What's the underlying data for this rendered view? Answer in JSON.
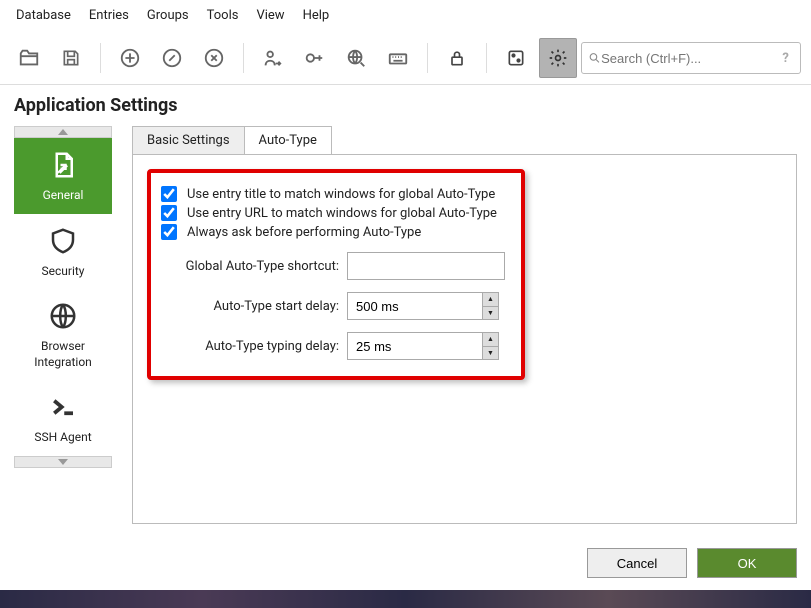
{
  "menubar": [
    "Database",
    "Entries",
    "Groups",
    "Tools",
    "View",
    "Help"
  ],
  "toolbar": {
    "search_placeholder": "Search (Ctrl+F)...",
    "help_icon": "?"
  },
  "page_title": "Application Settings",
  "sidebar": {
    "items": [
      {
        "label": "General"
      },
      {
        "label": "Security"
      },
      {
        "label": "Browser Integration"
      },
      {
        "label": "SSH Agent"
      }
    ]
  },
  "tabs": {
    "basic": "Basic Settings",
    "autotype": "Auto-Type"
  },
  "autotype": {
    "cb1": "Use entry title to match windows for global Auto-Type",
    "cb2": "Use entry URL to match windows for global Auto-Type",
    "cb3": "Always ask before performing Auto-Type",
    "shortcut_label": "Global Auto-Type shortcut:",
    "shortcut_value": "",
    "start_delay_label": "Auto-Type start delay:",
    "start_delay_value": "500 ms",
    "typing_delay_label": "Auto-Type typing delay:",
    "typing_delay_value": "25 ms"
  },
  "footer": {
    "cancel": "Cancel",
    "ok": "OK"
  }
}
